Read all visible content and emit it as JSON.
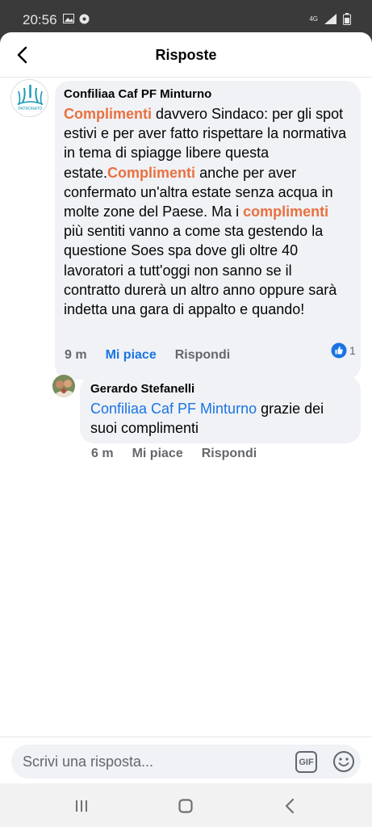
{
  "status_bar": {
    "time": "20:56",
    "network": "4G"
  },
  "header": {
    "title": "Risposte",
    "back_icon": "back-arrow-icon"
  },
  "comment": {
    "author": "Confiliaa Caf PF Minturno",
    "avatar_text": "PATRONATO",
    "segments": [
      {
        "text": "Complimenti",
        "highlight": true
      },
      {
        "text": " davvero Sindaco: per gli spot estivi e per aver fatto rispettare la normativa in tema di spiagge libere questa estate.",
        "highlight": false
      },
      {
        "text": "Complimenti",
        "highlight": true
      },
      {
        "text": " anche per aver confermato un'altra estate senza acqua in molte zone del Paese. Ma i ",
        "highlight": false
      },
      {
        "text": "complimenti",
        "highlight": true
      },
      {
        "text": " più sentiti vanno a come sta gestendo la questione Soes spa dove gli oltre 40 lavoratori a tutt'oggi non sanno se il contratto durerà un altro anno oppure sarà indetta una gara di appalto e quando!",
        "highlight": false
      }
    ],
    "time": "9 m",
    "like_label": "Mi piace",
    "reply_label": "Rispondi",
    "reaction_count": "1"
  },
  "reply": {
    "author": "Gerardo Stefanelli",
    "mention": "Confiliaa Caf PF Minturno",
    "text": " grazie dei suoi complimenti",
    "time": "6 m",
    "like_label": "Mi piace",
    "reply_label": "Rispondi"
  },
  "composer": {
    "placeholder": "Scrivi una risposta...",
    "gif_label": "GIF"
  },
  "colors": {
    "highlight": "#e9703f",
    "link": "#1b74e4",
    "bubble": "#f0f2f5",
    "meta": "#65676b"
  }
}
